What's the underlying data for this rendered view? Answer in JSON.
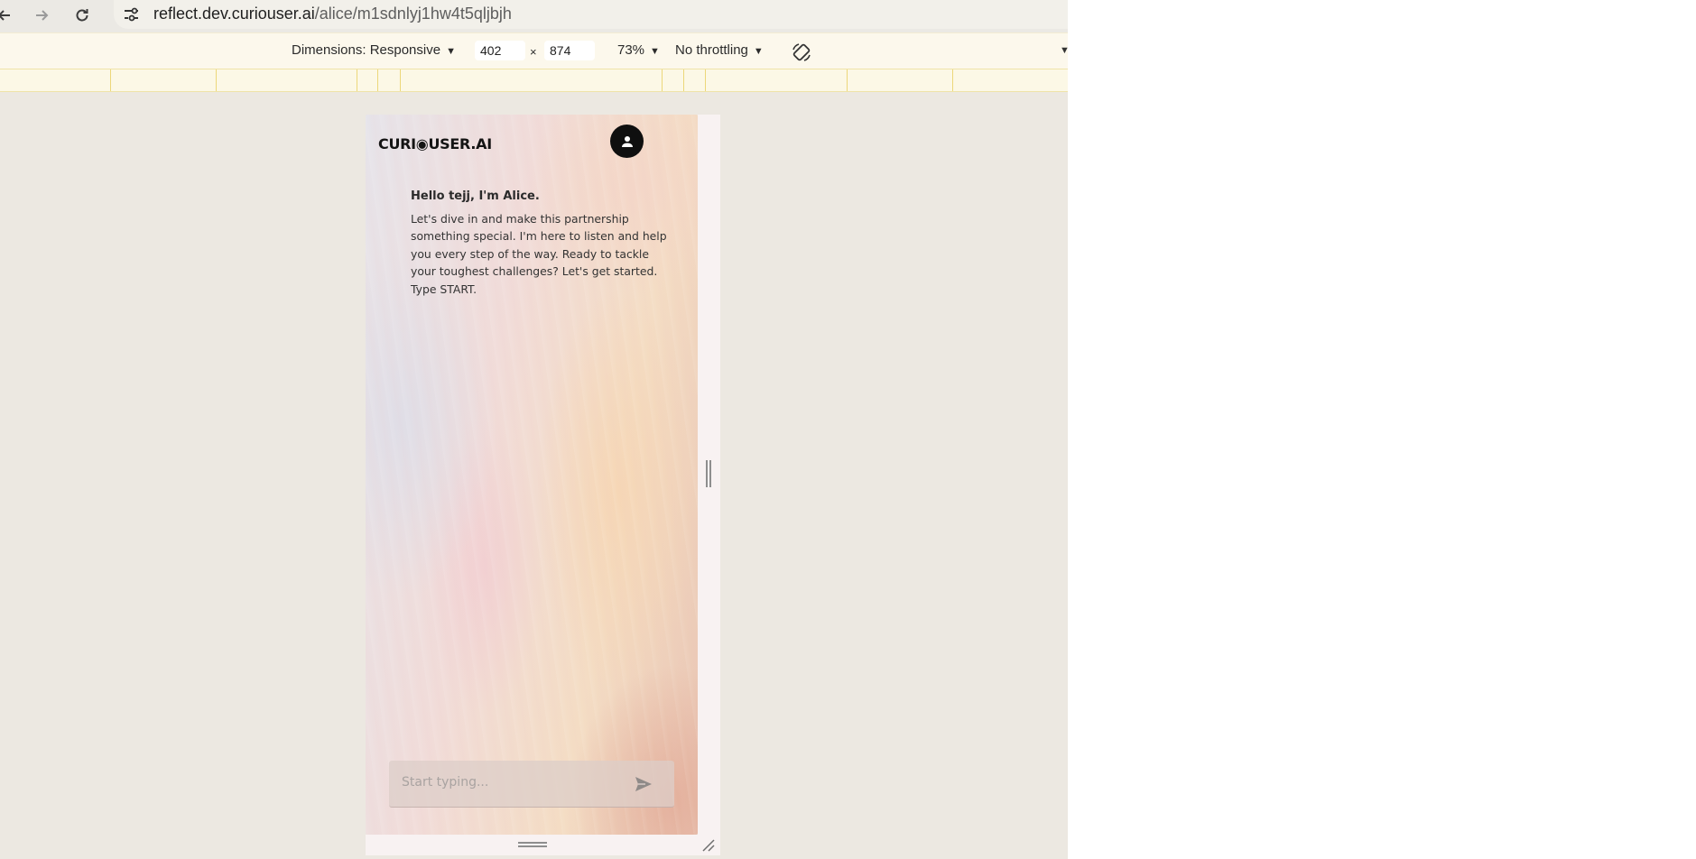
{
  "browser": {
    "url_host": "reflect.dev.curiouser.ai",
    "url_path": "/alice/m1sdnlyj1hw4t5qljbjh"
  },
  "device_toolbar": {
    "dimensions_label": "Dimensions: Responsive",
    "width_value": "402",
    "times": "×",
    "height_value": "874",
    "zoom_label": "73%",
    "throttling_label": "No throttling"
  },
  "app": {
    "logo": "CURI◉USER.AI",
    "greeting": "Hello tejj, I'm Alice.",
    "message": "Let's dive in and make this partnership something special. I'm here to listen and help you every step of the way. Ready to tackle your toughest challenges? Let's get started. Type START.",
    "input_placeholder": "Start typing..."
  },
  "icons": {
    "back": "arrow-left-icon",
    "forward": "arrow-right-icon",
    "reload": "reload-icon",
    "site_info": "tune-icon",
    "rotate": "rotate-device-icon",
    "avatar": "user-icon",
    "send": "send-icon"
  },
  "colors": {
    "avatar_bg": "#0f0f0f",
    "devbar_bg": "#fcf8ec",
    "ruler_line": "#ecd77a"
  }
}
